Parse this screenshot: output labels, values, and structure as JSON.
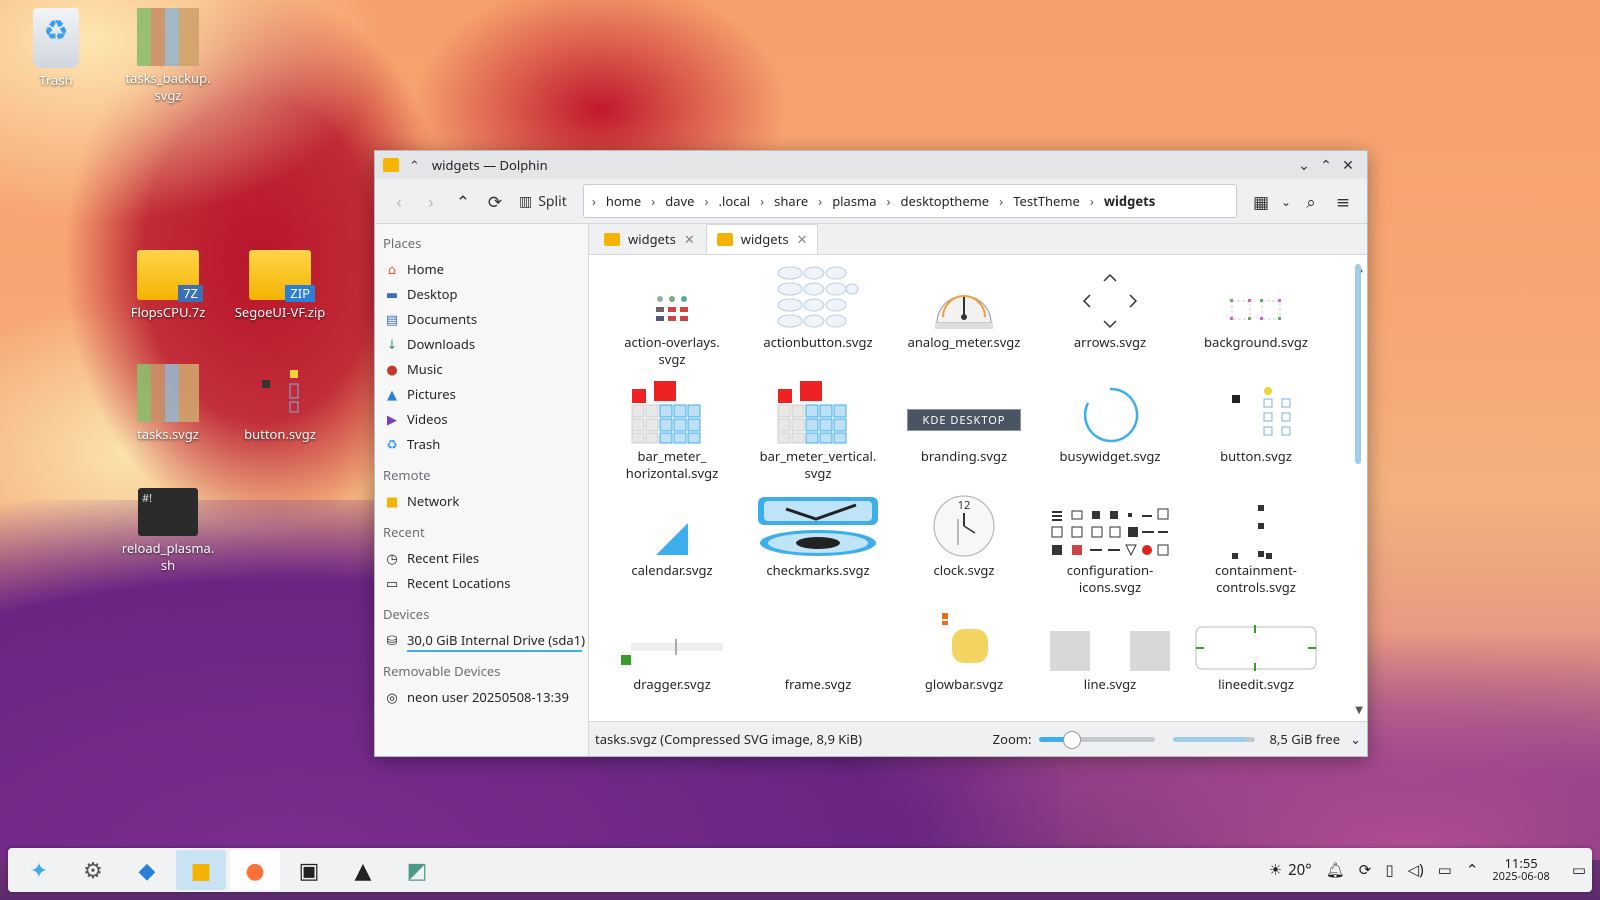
{
  "desktop": {
    "icons": [
      {
        "label": "Trash"
      },
      {
        "label": "tasks_backup.\nsvgz"
      },
      {
        "label": "FlopsCPU.7z",
        "badge": "7Z"
      },
      {
        "label": "SegoeUI-VF.zip",
        "badge": "ZIP"
      },
      {
        "label": "tasks.svgz"
      },
      {
        "label": "button.svgz"
      },
      {
        "label": "reload_plasma.\nsh",
        "glyph_text": "#!"
      }
    ]
  },
  "window": {
    "title": "widgets — Dolphin",
    "toolbar": {
      "split_label": "Split"
    },
    "breadcrumbs": [
      "home",
      "dave",
      ".local",
      "share",
      "plasma",
      "desktoptheme",
      "TestTheme",
      "widgets"
    ],
    "tabs": [
      {
        "label": "widgets"
      },
      {
        "label": "widgets"
      }
    ],
    "sidebar": {
      "places_title": "Places",
      "places": [
        "Home",
        "Desktop",
        "Documents",
        "Downloads",
        "Music",
        "Pictures",
        "Videos",
        "Trash"
      ],
      "remote_title": "Remote",
      "remote": [
        "Network"
      ],
      "recent_title": "Recent",
      "recent": [
        "Recent Files",
        "Recent Locations"
      ],
      "devices_title": "Devices",
      "devices": [
        "30,0 GiB Internal Drive (sda1)"
      ],
      "removable_title": "Removable Devices",
      "removable": [
        "neon user 20250508-13:39"
      ]
    },
    "files": [
      "action-overlays.\nsvgz",
      "actionbutton.svgz",
      "analog_meter.svgz",
      "arrows.svgz",
      "background.svgz",
      "bar_meter_\nhorizontal.svgz",
      "bar_meter_vertical.\nsvgz",
      "branding.svgz",
      "busywidget.svgz",
      "button.svgz",
      "calendar.svgz",
      "checkmarks.svgz",
      "clock.svgz",
      "configuration-\nicons.svgz",
      "containment-\ncontrols.svgz",
      "dragger.svgz",
      "frame.svgz",
      "glowbar.svgz",
      "line.svgz",
      "lineedit.svgz"
    ],
    "branding_text": "KDE DESKTOP",
    "clock_number": "12",
    "status": {
      "message": "tasks.svgz (Compressed SVG image, 8,9 KiB)",
      "zoom_label": "Zoom:",
      "zoom_fraction": 0.27,
      "free_label": "8,5 GiB free",
      "free_fraction": 0.9
    }
  },
  "taskbar": {
    "weather": "20°",
    "time": "11:55",
    "date": "2025-06-08"
  },
  "colors": {
    "accent": "#3daee9",
    "folder": "#f4b300"
  }
}
